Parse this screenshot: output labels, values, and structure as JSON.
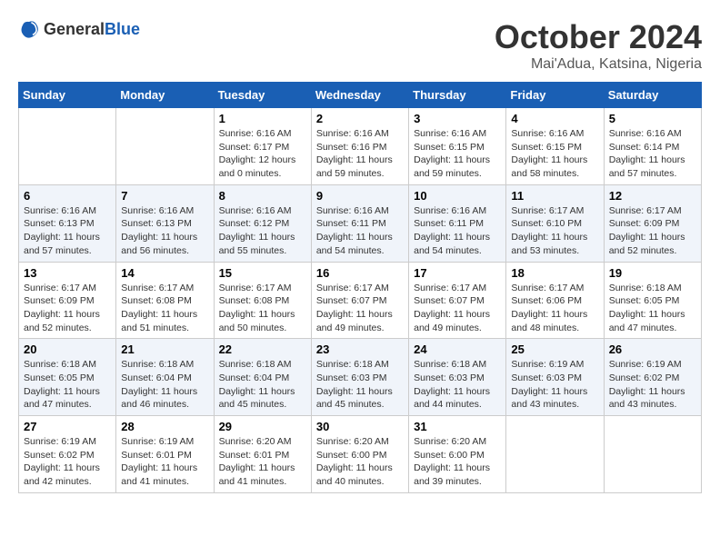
{
  "logo": {
    "general": "General",
    "blue": "Blue"
  },
  "title": "October 2024",
  "location": "Mai'Adua, Katsina, Nigeria",
  "headers": [
    "Sunday",
    "Monday",
    "Tuesday",
    "Wednesday",
    "Thursday",
    "Friday",
    "Saturday"
  ],
  "weeks": [
    [
      {
        "day": "",
        "sunrise": "",
        "sunset": "",
        "daylight": ""
      },
      {
        "day": "",
        "sunrise": "",
        "sunset": "",
        "daylight": ""
      },
      {
        "day": "1",
        "sunrise": "Sunrise: 6:16 AM",
        "sunset": "Sunset: 6:17 PM",
        "daylight": "Daylight: 12 hours and 0 minutes."
      },
      {
        "day": "2",
        "sunrise": "Sunrise: 6:16 AM",
        "sunset": "Sunset: 6:16 PM",
        "daylight": "Daylight: 11 hours and 59 minutes."
      },
      {
        "day": "3",
        "sunrise": "Sunrise: 6:16 AM",
        "sunset": "Sunset: 6:15 PM",
        "daylight": "Daylight: 11 hours and 59 minutes."
      },
      {
        "day": "4",
        "sunrise": "Sunrise: 6:16 AM",
        "sunset": "Sunset: 6:15 PM",
        "daylight": "Daylight: 11 hours and 58 minutes."
      },
      {
        "day": "5",
        "sunrise": "Sunrise: 6:16 AM",
        "sunset": "Sunset: 6:14 PM",
        "daylight": "Daylight: 11 hours and 57 minutes."
      }
    ],
    [
      {
        "day": "6",
        "sunrise": "Sunrise: 6:16 AM",
        "sunset": "Sunset: 6:13 PM",
        "daylight": "Daylight: 11 hours and 57 minutes."
      },
      {
        "day": "7",
        "sunrise": "Sunrise: 6:16 AM",
        "sunset": "Sunset: 6:13 PM",
        "daylight": "Daylight: 11 hours and 56 minutes."
      },
      {
        "day": "8",
        "sunrise": "Sunrise: 6:16 AM",
        "sunset": "Sunset: 6:12 PM",
        "daylight": "Daylight: 11 hours and 55 minutes."
      },
      {
        "day": "9",
        "sunrise": "Sunrise: 6:16 AM",
        "sunset": "Sunset: 6:11 PM",
        "daylight": "Daylight: 11 hours and 54 minutes."
      },
      {
        "day": "10",
        "sunrise": "Sunrise: 6:16 AM",
        "sunset": "Sunset: 6:11 PM",
        "daylight": "Daylight: 11 hours and 54 minutes."
      },
      {
        "day": "11",
        "sunrise": "Sunrise: 6:17 AM",
        "sunset": "Sunset: 6:10 PM",
        "daylight": "Daylight: 11 hours and 53 minutes."
      },
      {
        "day": "12",
        "sunrise": "Sunrise: 6:17 AM",
        "sunset": "Sunset: 6:09 PM",
        "daylight": "Daylight: 11 hours and 52 minutes."
      }
    ],
    [
      {
        "day": "13",
        "sunrise": "Sunrise: 6:17 AM",
        "sunset": "Sunset: 6:09 PM",
        "daylight": "Daylight: 11 hours and 52 minutes."
      },
      {
        "day": "14",
        "sunrise": "Sunrise: 6:17 AM",
        "sunset": "Sunset: 6:08 PM",
        "daylight": "Daylight: 11 hours and 51 minutes."
      },
      {
        "day": "15",
        "sunrise": "Sunrise: 6:17 AM",
        "sunset": "Sunset: 6:08 PM",
        "daylight": "Daylight: 11 hours and 50 minutes."
      },
      {
        "day": "16",
        "sunrise": "Sunrise: 6:17 AM",
        "sunset": "Sunset: 6:07 PM",
        "daylight": "Daylight: 11 hours and 49 minutes."
      },
      {
        "day": "17",
        "sunrise": "Sunrise: 6:17 AM",
        "sunset": "Sunset: 6:07 PM",
        "daylight": "Daylight: 11 hours and 49 minutes."
      },
      {
        "day": "18",
        "sunrise": "Sunrise: 6:17 AM",
        "sunset": "Sunset: 6:06 PM",
        "daylight": "Daylight: 11 hours and 48 minutes."
      },
      {
        "day": "19",
        "sunrise": "Sunrise: 6:18 AM",
        "sunset": "Sunset: 6:05 PM",
        "daylight": "Daylight: 11 hours and 47 minutes."
      }
    ],
    [
      {
        "day": "20",
        "sunrise": "Sunrise: 6:18 AM",
        "sunset": "Sunset: 6:05 PM",
        "daylight": "Daylight: 11 hours and 47 minutes."
      },
      {
        "day": "21",
        "sunrise": "Sunrise: 6:18 AM",
        "sunset": "Sunset: 6:04 PM",
        "daylight": "Daylight: 11 hours and 46 minutes."
      },
      {
        "day": "22",
        "sunrise": "Sunrise: 6:18 AM",
        "sunset": "Sunset: 6:04 PM",
        "daylight": "Daylight: 11 hours and 45 minutes."
      },
      {
        "day": "23",
        "sunrise": "Sunrise: 6:18 AM",
        "sunset": "Sunset: 6:03 PM",
        "daylight": "Daylight: 11 hours and 45 minutes."
      },
      {
        "day": "24",
        "sunrise": "Sunrise: 6:18 AM",
        "sunset": "Sunset: 6:03 PM",
        "daylight": "Daylight: 11 hours and 44 minutes."
      },
      {
        "day": "25",
        "sunrise": "Sunrise: 6:19 AM",
        "sunset": "Sunset: 6:03 PM",
        "daylight": "Daylight: 11 hours and 43 minutes."
      },
      {
        "day": "26",
        "sunrise": "Sunrise: 6:19 AM",
        "sunset": "Sunset: 6:02 PM",
        "daylight": "Daylight: 11 hours and 43 minutes."
      }
    ],
    [
      {
        "day": "27",
        "sunrise": "Sunrise: 6:19 AM",
        "sunset": "Sunset: 6:02 PM",
        "daylight": "Daylight: 11 hours and 42 minutes."
      },
      {
        "day": "28",
        "sunrise": "Sunrise: 6:19 AM",
        "sunset": "Sunset: 6:01 PM",
        "daylight": "Daylight: 11 hours and 41 minutes."
      },
      {
        "day": "29",
        "sunrise": "Sunrise: 6:20 AM",
        "sunset": "Sunset: 6:01 PM",
        "daylight": "Daylight: 11 hours and 41 minutes."
      },
      {
        "day": "30",
        "sunrise": "Sunrise: 6:20 AM",
        "sunset": "Sunset: 6:00 PM",
        "daylight": "Daylight: 11 hours and 40 minutes."
      },
      {
        "day": "31",
        "sunrise": "Sunrise: 6:20 AM",
        "sunset": "Sunset: 6:00 PM",
        "daylight": "Daylight: 11 hours and 39 minutes."
      },
      {
        "day": "",
        "sunrise": "",
        "sunset": "",
        "daylight": ""
      },
      {
        "day": "",
        "sunrise": "",
        "sunset": "",
        "daylight": ""
      }
    ]
  ]
}
